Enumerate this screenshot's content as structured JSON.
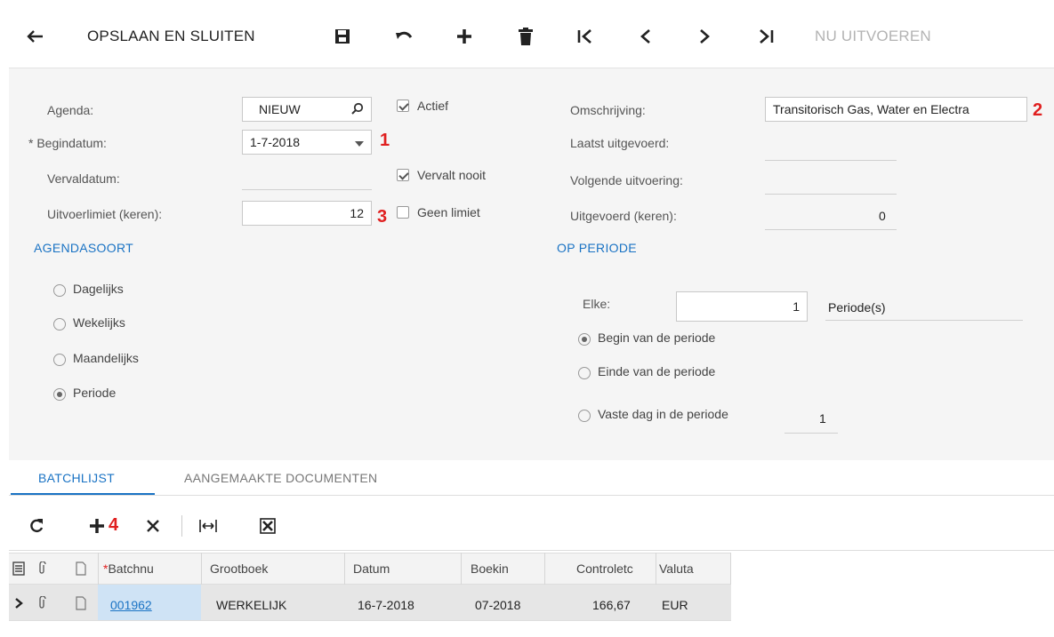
{
  "toolbar": {
    "save_close": "OPSLAAN EN SLUITEN",
    "run_now": "NU UITVOEREN"
  },
  "form": {
    "agenda_label": "Agenda:",
    "agenda_value": "NIEUW",
    "active_label": "Actief",
    "active_checked": true,
    "begindatum_label": "Begindatum:",
    "begindatum_value": "1-7-2018",
    "vervaldatum_label": "Vervaldatum:",
    "vervalt_nooit_label": "Vervalt nooit",
    "vervalt_nooit_checked": true,
    "uitvoerlimiet_label": "Uitvoerlimiet (keren):",
    "uitvoerlimiet_value": "12",
    "geen_limiet_label": "Geen limiet",
    "geen_limiet_checked": false,
    "omschrijving_label": "Omschrijving:",
    "omschrijving_value": "Transitorisch Gas, Water en Electra",
    "laatst_label": "Laatst uitgevoerd:",
    "volgende_label": "Volgende uitvoering:",
    "uitgevoerd_label": "Uitgevoerd (keren):",
    "uitgevoerd_value": "0"
  },
  "agendasoort": {
    "title": "AGENDASOORT",
    "options": [
      "Dagelijks",
      "Wekelijks",
      "Maandelijks",
      "Periode"
    ],
    "selected": "Periode"
  },
  "op_periode": {
    "title": "OP PERIODE",
    "elke_label": "Elke:",
    "elke_value": "1",
    "periode_unit": "Periode(s)",
    "begin_label": "Begin van de periode",
    "einde_label": "Einde van de periode",
    "vaste_label": "Vaste dag in de periode",
    "vaste_value": "1",
    "selected": "Begin van de periode"
  },
  "markers": {
    "m1": "1",
    "m2": "2",
    "m3": "3",
    "m4": "4"
  },
  "tabs": {
    "batchlijst": "BATCHLIJST",
    "documenten": "AANGEMAAKTE DOCUMENTEN"
  },
  "grid": {
    "columns": {
      "batch": "Batchnu",
      "grootboek": "Grootboek",
      "datum": "Datum",
      "boekin": "Boekin",
      "controle": "Controletc",
      "valuta": "Valuta"
    },
    "rows": [
      {
        "batch": "001962",
        "grootboek": "WERKELIJK",
        "datum": "16-7-2018",
        "boekin": "07-2018",
        "controle": "166,67",
        "valuta": "EUR"
      }
    ]
  },
  "colors": {
    "accent": "#1a73c4",
    "marker": "#e02020"
  }
}
